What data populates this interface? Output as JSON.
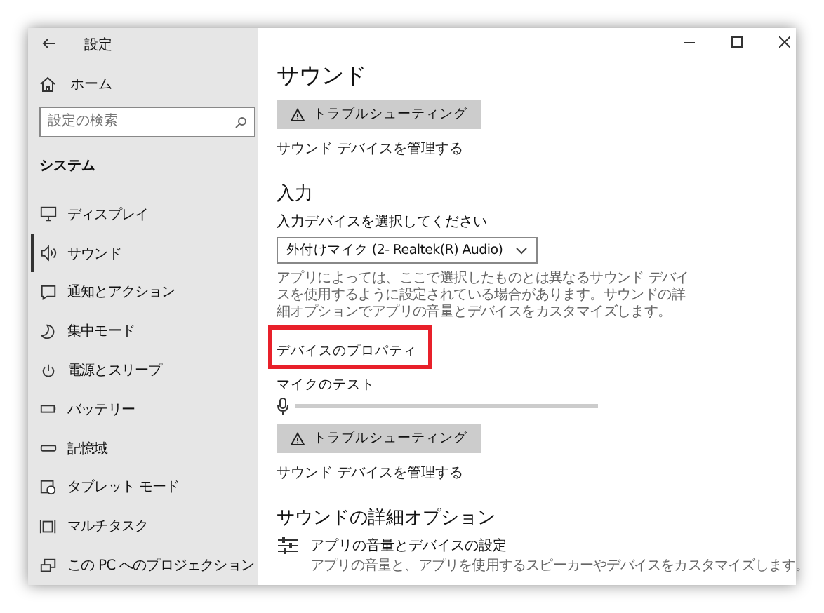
{
  "window": {
    "title": "設定"
  },
  "sidebar": {
    "home": "ホーム",
    "search": {
      "placeholder": "設定の検索"
    },
    "section": "システム",
    "items": [
      {
        "label": "ディスプレイ",
        "selected": false
      },
      {
        "label": "サウンド",
        "selected": true
      },
      {
        "label": "通知とアクション",
        "selected": false
      },
      {
        "label": "集中モード",
        "selected": false
      },
      {
        "label": "電源とスリープ",
        "selected": false
      },
      {
        "label": "バッテリー",
        "selected": false
      },
      {
        "label": "記憶域",
        "selected": false
      },
      {
        "label": "タブレット モード",
        "selected": false
      },
      {
        "label": "マルチタスク",
        "selected": false
      },
      {
        "label": "この PC へのプロジェクション",
        "selected": false
      }
    ]
  },
  "content": {
    "title": "サウンド",
    "top_troubleshoot": "トラブルシューティング",
    "top_manage_link": "サウンド デバイスを管理する",
    "input": {
      "heading": "入力",
      "device_label": "入力デバイスを選択してください",
      "device_value": "外付けマイク (2- Realtek(R) Audio)",
      "description": "アプリによっては、ここで選択したものとは異なるサウンド デバイスを使用するように設定されている場合があります。サウンドの詳細オプションでアプリの音量とデバイスをカスタマイズします。",
      "properties_link": {
        "label": "デバイスのプロパティ",
        "highlighted": true
      },
      "mic_test_label": "マイクのテスト",
      "mic_level": {
        "level": 0
      },
      "troubleshoot": "トラブルシューティング",
      "manage_link": "サウンド デバイスを管理する"
    },
    "advanced": {
      "heading": "サウンドの詳細オプション",
      "item_title": "アプリの音量とデバイスの設定",
      "item_desc": "アプリの音量と、アプリを使用するスピーカーやデバイスをカスタマイズします。"
    }
  }
}
